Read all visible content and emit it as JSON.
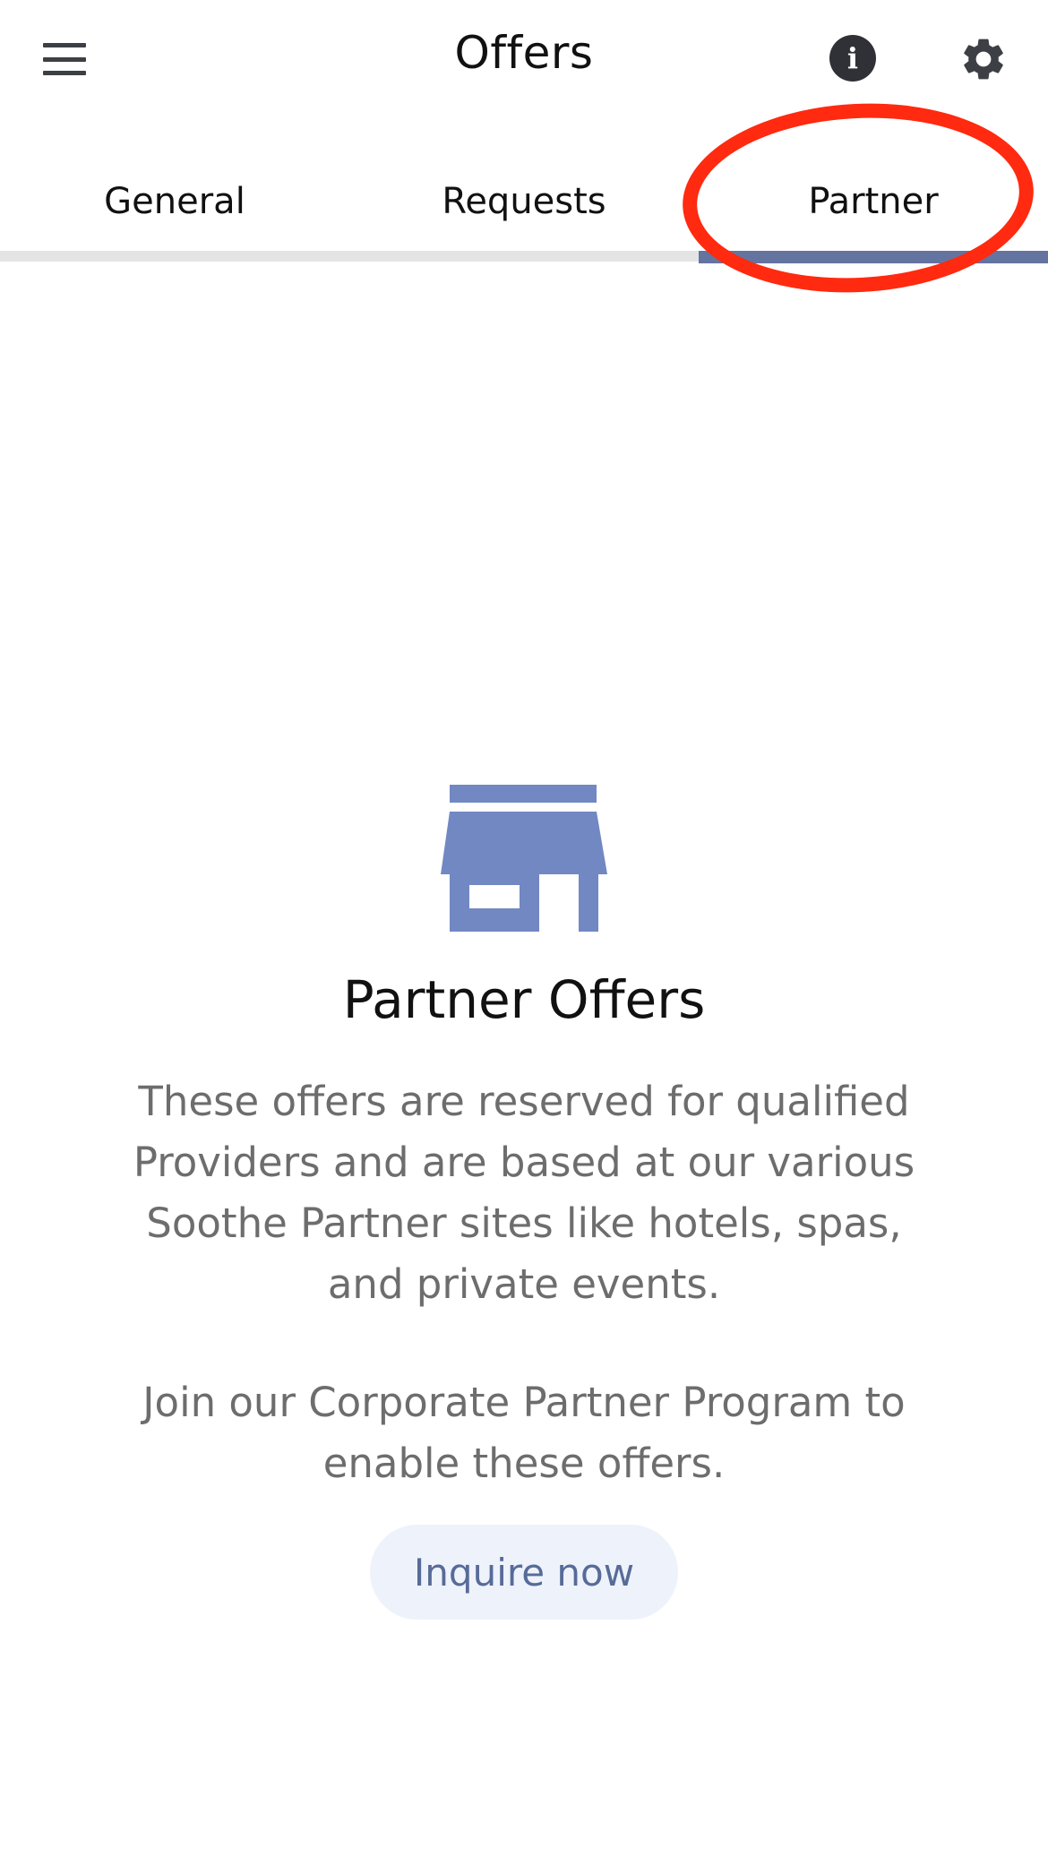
{
  "header": {
    "title": "Offers",
    "menu_icon": "hamburger-menu-icon",
    "info_icon": "info-icon",
    "info_glyph": "i",
    "settings_icon": "gear-icon"
  },
  "tabs": [
    {
      "label": "General",
      "selected": false
    },
    {
      "label": "Requests",
      "selected": false
    },
    {
      "label": "Partner",
      "selected": true
    }
  ],
  "empty_state": {
    "icon": "storefront-icon",
    "title": "Partner Offers",
    "description": "These offers are reserved for qualified Providers and are based at our various Soothe Partner sites like hotels, spas, and private events.",
    "cta_text": "Join our Corporate Partner Program to enable these offers.",
    "button_label": "Inquire now"
  },
  "colors": {
    "accent": "#6474a1",
    "icon_fill": "#7188c2",
    "annotation": "#ff2a0f",
    "button_bg": "#eef2fb",
    "button_text": "#576b98",
    "body_text": "#6d6d6d"
  }
}
